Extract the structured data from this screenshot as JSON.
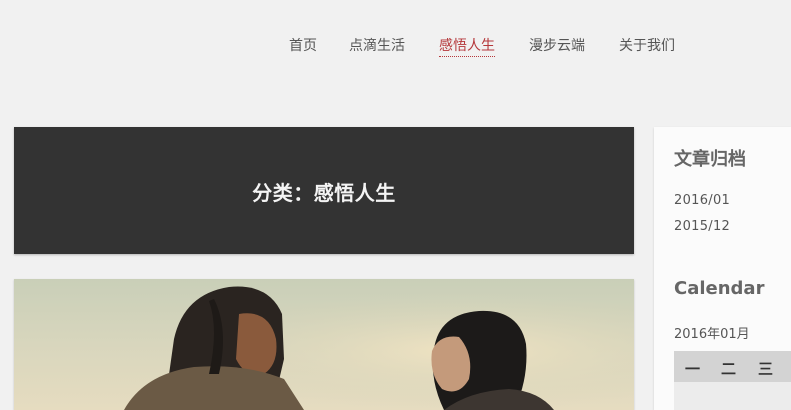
{
  "nav": {
    "items": [
      {
        "label": "首页",
        "active": false
      },
      {
        "label": "点滴生活",
        "active": false
      },
      {
        "label": "感悟人生",
        "active": true
      },
      {
        "label": "漫步云端",
        "active": false
      },
      {
        "label": "关于我们",
        "active": false
      }
    ],
    "accent_color": "#b5383b"
  },
  "category": {
    "title": "分类：感悟人生",
    "banner_color": "#333333"
  },
  "sidebar": {
    "archive": {
      "title": "文章归档",
      "links": [
        "2016/01",
        "2015/12"
      ]
    },
    "calendar": {
      "title": "Calendar",
      "month": "2016年01月",
      "weekdays": [
        "一",
        "二",
        "三"
      ]
    }
  }
}
